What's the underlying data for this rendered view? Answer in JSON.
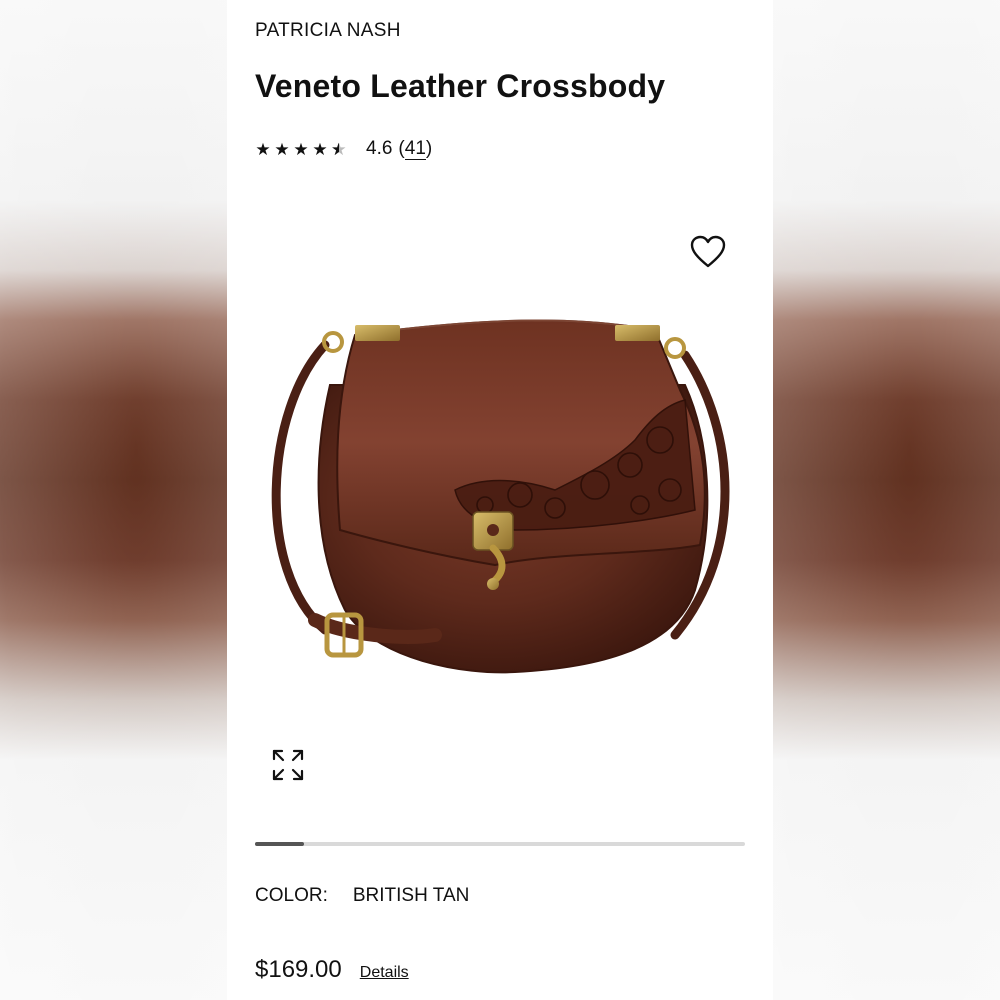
{
  "product": {
    "brand": "PATRICIA NASH",
    "title": "Veneto Leather Crossbody",
    "rating": {
      "stars": 4.6,
      "value_text": "4.6",
      "open_paren": "(",
      "count_text": "41",
      "close_paren": ")"
    },
    "color_label": "COLOR:",
    "color_value": "BRITISH TAN",
    "price": "$169.00",
    "details_label": "Details"
  },
  "gallery": {
    "progress": 0.1
  },
  "icons": {
    "wishlist": "heart-outline-icon",
    "expand": "expand-arrows-icon",
    "star_full": "star-icon",
    "star_half": "star-half-icon"
  },
  "colors": {
    "text": "#111111",
    "leather": "#5e2a1c",
    "hardware": "#b8963f",
    "progress_track": "#d9d9d9",
    "progress_fill": "#555555"
  }
}
